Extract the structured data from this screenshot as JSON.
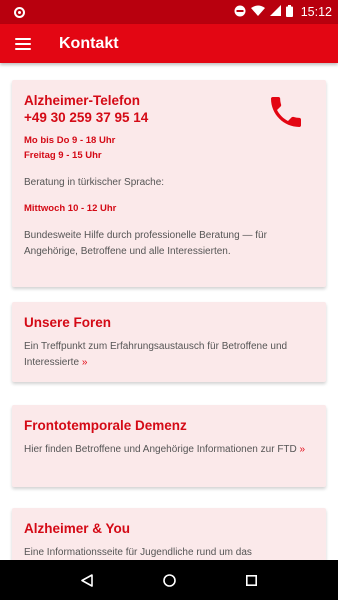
{
  "status_bar": {
    "time": "15:12",
    "icons": [
      "notification-dot-icon",
      "do-not-disturb-icon",
      "wifi-icon",
      "signal-icon",
      "battery-icon"
    ]
  },
  "app_bar": {
    "menu_icon": "hamburger-menu-icon",
    "title": "Kontakt",
    "color": "#e30613"
  },
  "cards": {
    "telefon": {
      "title": "Alzheimer-Telefon",
      "phone": "+49 30 259 37 95 14",
      "hours_weekdays": "Mo bis Do 9 - 18 Uhr",
      "hours_friday": "Freitag 9 - 15 Uhr",
      "turkish_label": "Beratung in türkischer Sprache:",
      "turkish_hours": "Mittwoch 10 - 12 Uhr",
      "description": "Bundesweite Hilfe durch professionelle Beratung — für Angehörige, Betroffene und alle Interessierten.",
      "icon": "phone-icon"
    },
    "foren": {
      "title": "Unsere Foren",
      "text": "Ein Treffpunkt zum Erfahrungsaustausch für Betroffene und Interessierte",
      "link": "»"
    },
    "ftd": {
      "title": "Frontotemporale Demenz",
      "text": "Hier finden Betroffene und Angehörige Informationen zur FTD",
      "link": "»"
    },
    "you": {
      "title": "Alzheimer & You",
      "text": "Eine Informationsseite für Jugendliche rund um das"
    }
  },
  "nav_bar": {
    "buttons": [
      "back-icon",
      "home-icon",
      "recents-icon"
    ]
  },
  "colors": {
    "accent": "#e30613",
    "status_bar": "#b8000e",
    "card_background": "#fbe9ea"
  }
}
